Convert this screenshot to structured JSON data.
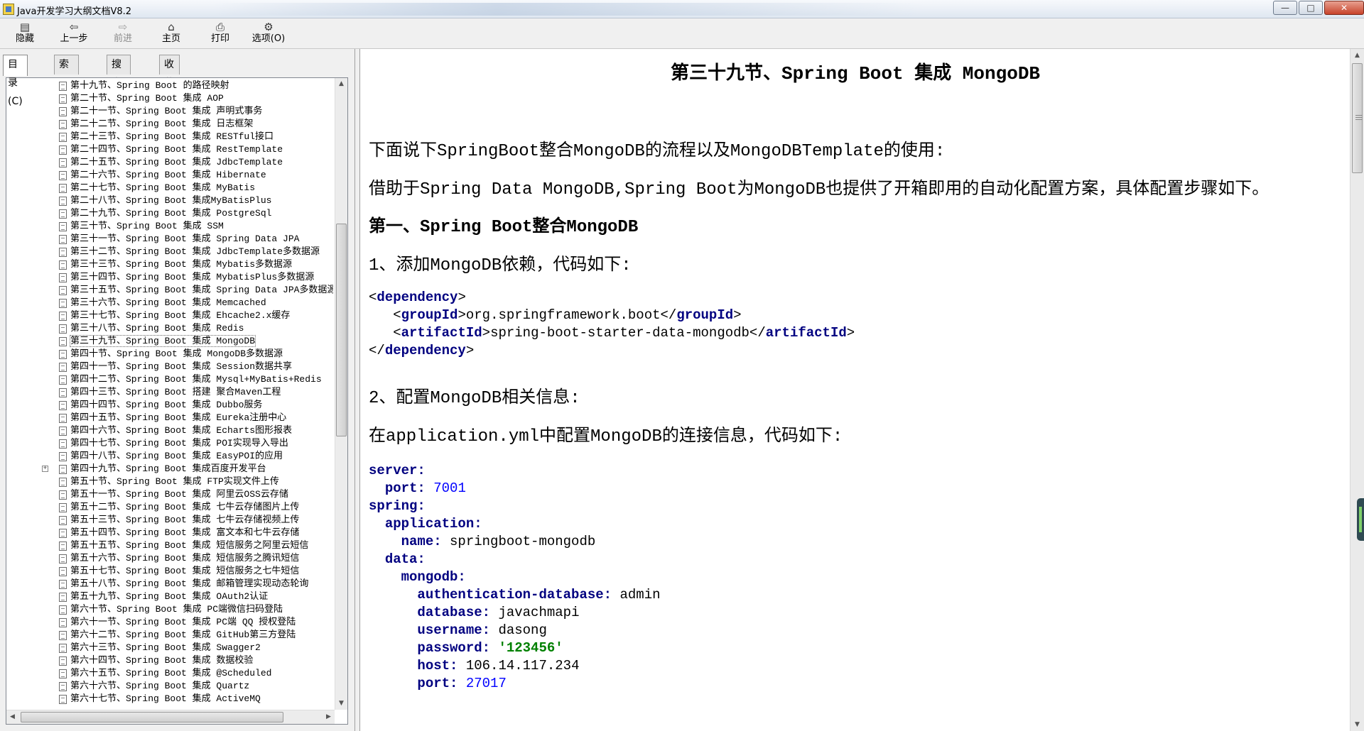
{
  "window": {
    "title": "Java开发学习大纲文档V8.2",
    "minimize": "—",
    "maximize": "□",
    "close": "✕"
  },
  "toolbar": [
    {
      "label": "隐藏",
      "icon": "hide-icon",
      "glyph": "▤"
    },
    {
      "label": "上一步",
      "icon": "back-icon",
      "glyph": "⇦"
    },
    {
      "label": "前进",
      "icon": "forward-icon",
      "glyph": "⇨",
      "disabled": true
    },
    {
      "label": "主页",
      "icon": "home-icon",
      "glyph": "⌂"
    },
    {
      "label": "打印",
      "icon": "print-icon",
      "glyph": "⎙"
    },
    {
      "label": "选项(O)",
      "icon": "options-icon",
      "glyph": "⚙"
    }
  ],
  "tabs": [
    "目录(C)",
    "索引(N)",
    "搜索(S)",
    "收藏夹(I)"
  ],
  "tree": [
    "第十九节、Spring Boot 的路径映射",
    "第二十节、Spring Boot 集成 AOP",
    "第二十一节、Spring Boot 集成 声明式事务",
    "第二十二节、Spring Boot 集成 日志框架",
    "第二十三节、Spring Boot 集成 RESTful接口",
    "第二十四节、Spring Boot 集成 RestTemplate",
    "第二十五节、Spring Boot 集成 JdbcTemplate",
    "第二十六节、Spring Boot 集成 Hibernate",
    "第二十七节、Spring Boot 集成 MyBatis",
    "第二十八节、Spring Boot 集成MyBatisPlus",
    "第二十九节、Spring Boot 集成 PostgreSql",
    "第三十节、Spring Boot 集成 SSM",
    "第三十一节、Spring Boot 集成 Spring Data JPA",
    "第三十二节、Spring Boot 集成 JdbcTemplate多数据源",
    "第三十三节、Spring Boot 集成 Mybatis多数据源",
    "第三十四节、Spring Boot 集成 MybatisPlus多数据源",
    "第三十五节、Spring Boot 集成 Spring Data JPA多数据源",
    "第三十六节、Spring Boot 集成 Memcached",
    "第三十七节、Spring Boot 集成 Ehcache2.x缓存",
    "第三十八节、Spring Boot 集成 Redis",
    "第三十九节、Spring Boot 集成 MongoDB",
    "第四十节、Spring Boot 集成 MongoDB多数据源",
    "第四十一节、Spring Boot 集成 Session数据共享",
    "第四十二节、Spring Boot 集成 Mysql+MyBatis+Redis",
    "第四十三节、Spring Boot 搭建 聚合Maven工程",
    "第四十四节、Spring Boot 集成 Dubbo服务",
    "第四十五节、Spring Boot 集成 Eureka注册中心",
    "第四十六节、Spring Boot 集成 Echarts图形报表",
    "第四十七节、Spring Boot 集成 POI实现导入导出",
    "第四十八节、Spring Boot 集成 EasyPOI的应用",
    "第四十九节、Spring Boot 集成百度开发平台",
    "第五十节、Spring Boot 集成 FTP实现文件上传",
    "第五十一节、Spring Boot 集成 阿里云OSS云存储",
    "第五十二节、Spring Boot 集成 七牛云存储图片上传",
    "第五十三节、Spring Boot 集成 七牛云存储视频上传",
    "第五十四节、Spring Boot 集成 富文本和七牛云存储",
    "第五十五节、Spring Boot 集成 短信服务之阿里云短信",
    "第五十六节、Spring Boot 集成 短信服务之腾讯短信",
    "第五十七节、Spring Boot 集成 短信服务之七牛短信",
    "第五十八节、Spring Boot 集成 邮箱管理实现动态轮询",
    "第五十九节、Spring Boot 集成 OAuth2认证",
    "第六十节、Spring Boot 集成 PC端微信扫码登陆",
    "第六十一节、Spring Boot 集成 PC端 QQ 授权登陆",
    "第六十二节、Spring Boot 集成 GitHub第三方登陆",
    "第六十三节、Spring Boot 集成 Swagger2",
    "第六十四节、Spring Boot 集成 数据校验",
    "第六十五节、Spring Boot 集成 @Scheduled",
    "第六十六节、Spring Boot 集成 Quartz",
    "第六十七节、Spring Boot 集成 ActiveMQ"
  ],
  "tree_selected_index": 20,
  "tree_expandable_index": 30,
  "article": {
    "title": "第三十九节、Spring Boot 集成 MongoDB",
    "p1": "下面说下SpringBoot整合MongoDB的流程以及MongoDBTemplate的使用:",
    "p2": "借助于Spring Data MongoDB,Spring Boot为MongoDB也提供了开箱即用的自动化配置方案，具体配置步骤如下。",
    "h1": "第一、Spring Boot整合MongoDB",
    "step1": "1、添加MongoDB依赖，代码如下:",
    "xml": {
      "dependency": "dependency",
      "groupId_tag": "groupId",
      "groupId_val": "org.springframework.boot",
      "artifactId_tag": "artifactId",
      "artifactId_val": "spring-boot-starter-data-mongodb"
    },
    "step2": "2、配置MongoDB相关信息:",
    "p3": "在application.yml中配置MongoDB的连接信息，代码如下:",
    "yml": {
      "server": "server:",
      "port_key": "port:",
      "port_val": "7001",
      "spring": "spring:",
      "application": "application:",
      "name_key": "name:",
      "name_val": "springboot-mongodb",
      "data": "data:",
      "mongodb": "mongodb:",
      "authdb_key": "authentication-database:",
      "authdb_val": "admin",
      "database_key": "database:",
      "database_val": "javachmapi",
      "username_key": "username:",
      "username_val": "dasong",
      "password_key": "password:",
      "password_val": "'123456'",
      "host_key": "host:",
      "host_val": "106.14.117.234",
      "port2_key": "port:",
      "port2_val": "27017"
    }
  }
}
